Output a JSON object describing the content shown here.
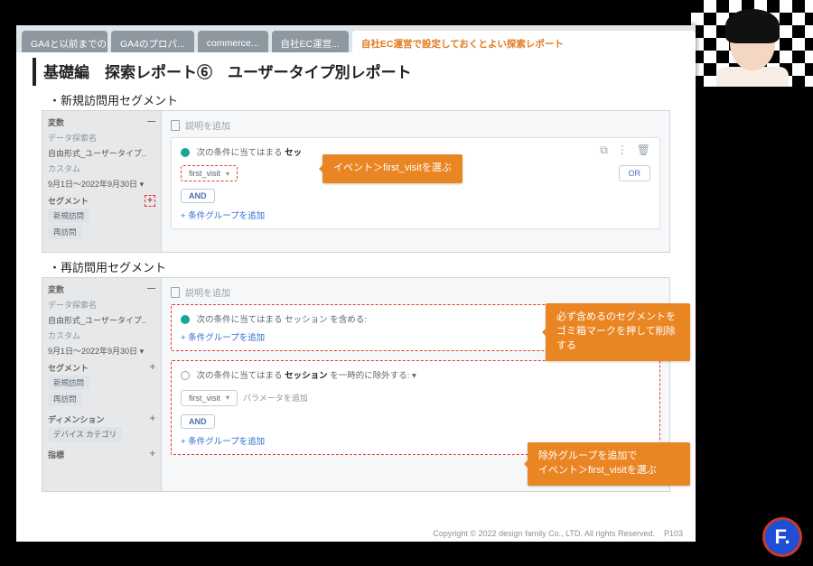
{
  "tabs": {
    "t1": "GA4と以前までの...",
    "t2": "GA4のプロパ...",
    "t3": "commerce...",
    "t4": "自社EC運営...",
    "active": "自社EC運営で設定しておくとよい探索レポート"
  },
  "title": "基礎編　探索レポート⑥　ユーザータイプ別レポート",
  "sub1": "・新規訪問用セグメント",
  "sub2": "・再訪問用セグメント",
  "sidebar": {
    "varHdr": "変数",
    "nameHdr": "データ探索名",
    "nameVal": "自由形式_ユーザータイプ..",
    "custom": "カスタム",
    "dates": "9月1日〜2022年9月30日",
    "segHdr": "セグメント",
    "seg1": "新規訪問",
    "seg2": "再訪問",
    "dimHdr": "ディメンション",
    "dim1": "デバイス カテゴリ",
    "metHdr": "指標"
  },
  "main": {
    "addDesc": "説明を追加",
    "cond1a": "次の条件に当てはまる ",
    "cond1b": "セッ",
    "cond2": "次の条件に当てはまる セッション を含める:",
    "cond3a": "次の条件に当てはまる ",
    "cond3b": "セッション",
    "cond3c": " を一時的に除外する:",
    "firstVisit": "first_visit",
    "param": "パラメータを追加",
    "and": "AND",
    "or": "OR",
    "addGroup": "条件グループを追加",
    "caret": "▾"
  },
  "callouts": {
    "c1": "イベント＞first_visitを選ぶ",
    "c2a": "必ず含めるのセグメントを",
    "c2b": "ゴミ箱マークを押して削除",
    "c2c": "する",
    "c3a": "除外グループを追加で",
    "c3b": "イベント＞first_visitを選ぶ"
  },
  "footer": {
    "copy": "Copyright © 2022 design family Co., LTD. All rights Reserved.",
    "page": "P103"
  },
  "logo": "F."
}
